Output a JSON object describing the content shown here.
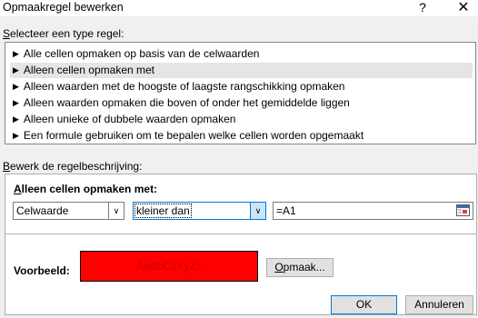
{
  "window": {
    "title": "Opmaakregel bewerken",
    "help_glyph": "?",
    "close_glyph": "✕"
  },
  "rule_type": {
    "label_accel": "S",
    "label_rest": "electeer een type regel:",
    "items": [
      {
        "label": "Alle cellen opmaken op basis van de celwaarden"
      },
      {
        "label": "Alleen cellen opmaken met"
      },
      {
        "label": "Alleen waarden met de hoogste of laagste rangschikking opmaken"
      },
      {
        "label": "Alleen waarden opmaken die boven of onder het gemiddelde liggen"
      },
      {
        "label": "Alleen unieke of dubbele waarden opmaken"
      },
      {
        "label": "Een formule gebruiken om te bepalen welke cellen worden opgemaakt"
      }
    ],
    "bullet": "▶"
  },
  "rule_description": {
    "label_accel": "B",
    "label_rest": "ewerk de regelbeschrijving:",
    "heading_accel": "A",
    "heading_rest": "lleen cellen opmaken met:",
    "condition_field": "Celwaarde",
    "operator": "kleiner dan",
    "reference": "=A1",
    "dropdown_glyph": "∨"
  },
  "preview": {
    "label_accel": "",
    "label": "Voorbeeld:",
    "sample_text": "AaBbCcYyZz",
    "fill_color": "#ff0000",
    "text_color": "#cc0000",
    "format_button_accel": "O",
    "format_button_rest": "pmaak..."
  },
  "buttons": {
    "ok": "OK",
    "cancel": "Annuleren"
  }
}
